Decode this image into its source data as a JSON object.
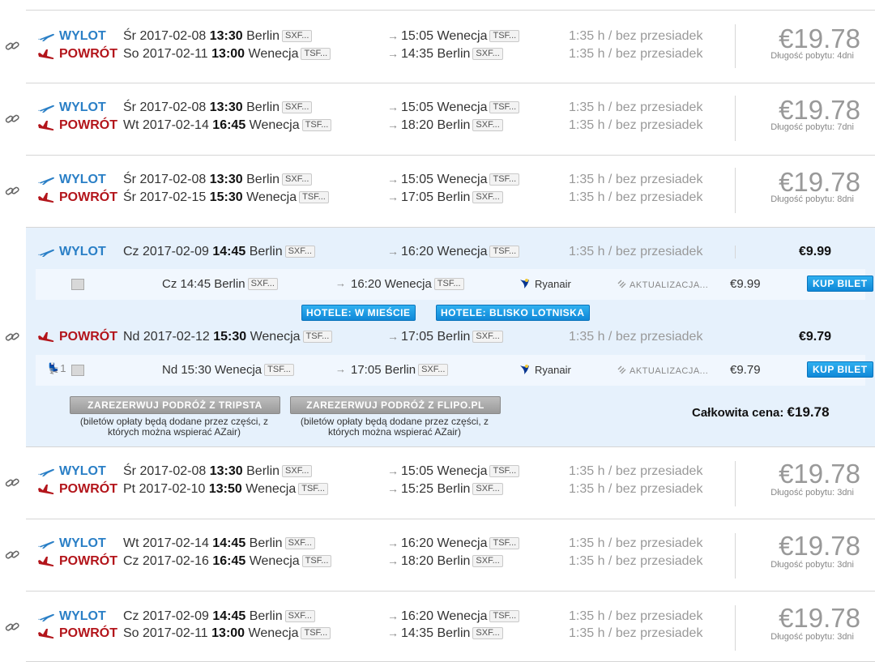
{
  "labels": {
    "outbound": "WYLOT",
    "return": "POWRÓT",
    "stay_prefix": "Długość pobytu:",
    "kup": "KUP BILET",
    "update": "AKTUALIZACJA...",
    "hotel_city": "HOTELE: W MIEŚCIE",
    "hotel_airport": "HOTELE: BLISKO LOTNISKA",
    "book_tripsta": "ZAREZERWUJ PODRÓŻ Z TRIPSTA",
    "book_flipo": "ZAREZERWUJ PODRÓŻ Z FLIPO.PL",
    "book_note": "(biletów opłaty będą dodane przez części, z których można wspierać AZair)",
    "total_label": "Całkowita cena:"
  },
  "results": [
    {
      "price": "€19.78",
      "stay": "Długość pobytu: 4dni",
      "out": {
        "day": "Śr",
        "date": "2017-02-08",
        "time": "13:30",
        "from": "Berlin",
        "from_code": "SXF...",
        "arr_time": "15:05",
        "to": "Wenecja",
        "to_code": "TSF...",
        "duration": "1:35 h / bez przesiadek"
      },
      "ret": {
        "day": "So",
        "date": "2017-02-11",
        "time": "13:00",
        "from": "Wenecja",
        "from_code": "TSF...",
        "arr_time": "14:35",
        "to": "Berlin",
        "to_code": "SXF...",
        "duration": "1:35 h / bez przesiadek"
      }
    },
    {
      "price": "€19.78",
      "stay": "Długość pobytu: 7dni",
      "out": {
        "day": "Śr",
        "date": "2017-02-08",
        "time": "13:30",
        "from": "Berlin",
        "from_code": "SXF...",
        "arr_time": "15:05",
        "to": "Wenecja",
        "to_code": "TSF...",
        "duration": "1:35 h / bez przesiadek"
      },
      "ret": {
        "day": "Wt",
        "date": "2017-02-14",
        "time": "16:45",
        "from": "Wenecja",
        "from_code": "TSF...",
        "arr_time": "18:20",
        "to": "Berlin",
        "to_code": "SXF...",
        "duration": "1:35 h / bez przesiadek"
      }
    },
    {
      "price": "€19.78",
      "stay": "Długość pobytu: 8dni",
      "out": {
        "day": "Śr",
        "date": "2017-02-08",
        "time": "13:30",
        "from": "Berlin",
        "from_code": "SXF...",
        "arr_time": "15:05",
        "to": "Wenecja",
        "to_code": "TSF...",
        "duration": "1:35 h / bez przesiadek"
      },
      "ret": {
        "day": "Śr",
        "date": "2017-02-15",
        "time": "15:30",
        "from": "Wenecja",
        "from_code": "TSF...",
        "arr_time": "17:05",
        "to": "Berlin",
        "to_code": "SXF...",
        "duration": "1:35 h / bez przesiadek"
      }
    },
    {
      "price": "€19.78",
      "stay": "Długość pobytu: 3dni",
      "out": {
        "day": "Śr",
        "date": "2017-02-08",
        "time": "13:30",
        "from": "Berlin",
        "from_code": "SXF...",
        "arr_time": "15:05",
        "to": "Wenecja",
        "to_code": "TSF...",
        "duration": "1:35 h / bez przesiadek"
      },
      "ret": {
        "day": "Pt",
        "date": "2017-02-10",
        "time": "13:50",
        "from": "Wenecja",
        "from_code": "TSF...",
        "arr_time": "15:25",
        "to": "Berlin",
        "to_code": "SXF...",
        "duration": "1:35 h / bez przesiadek"
      }
    },
    {
      "price": "€19.78",
      "stay": "Długość pobytu: 3dni",
      "out": {
        "day": "Wt",
        "date": "2017-02-14",
        "time": "14:45",
        "from": "Berlin",
        "from_code": "SXF...",
        "arr_time": "16:20",
        "to": "Wenecja",
        "to_code": "TSF...",
        "duration": "1:35 h / bez przesiadek"
      },
      "ret": {
        "day": "Cz",
        "date": "2017-02-16",
        "time": "16:45",
        "from": "Wenecja",
        "from_code": "TSF...",
        "arr_time": "18:20",
        "to": "Berlin",
        "to_code": "SXF...",
        "duration": "1:35 h / bez przesiadek"
      }
    },
    {
      "price": "€19.78",
      "stay": "Długość pobytu: 3dni",
      "out": {
        "day": "Cz",
        "date": "2017-02-09",
        "time": "14:45",
        "from": "Berlin",
        "from_code": "SXF...",
        "arr_time": "16:20",
        "to": "Wenecja",
        "to_code": "TSF...",
        "duration": "1:35 h / bez przesiadek"
      },
      "ret": {
        "day": "So",
        "date": "2017-02-11",
        "time": "13:00",
        "from": "Wenecja",
        "from_code": "TSF...",
        "arr_time": "14:35",
        "to": "Berlin",
        "to_code": "SXF...",
        "duration": "1:35 h / bez przesiadek"
      }
    }
  ],
  "expanded": {
    "total": "€19.78",
    "out": {
      "day": "Cz",
      "date": "2017-02-09",
      "time": "14:45",
      "from": "Berlin",
      "from_code": "SXF...",
      "arr_time": "16:20",
      "to": "Wenecja",
      "to_code": "TSF...",
      "duration": "1:35 h / bez przesiadek",
      "price": "€9.99",
      "segment": {
        "dep": "Cz 14:45 Berlin",
        "dep_code": "SXF...",
        "arr": "16:20 Wenecja",
        "arr_code": "TSF...",
        "airline": "Ryanair",
        "price": "€9.99"
      }
    },
    "ret": {
      "day": "Nd",
      "date": "2017-02-12",
      "time": "15:30",
      "from": "Wenecja",
      "from_code": "TSF...",
      "arr_time": "17:05",
      "to": "Berlin",
      "to_code": "SXF...",
      "duration": "1:35 h / bez przesiadek",
      "price": "€9.79",
      "segment": {
        "seats": "1",
        "dep": "Nd 15:30 Wenecja",
        "dep_code": "TSF...",
        "arr": "17:05 Berlin",
        "arr_code": "SXF...",
        "airline": "Ryanair",
        "price": "€9.79"
      }
    }
  },
  "icons": {
    "link": "link-icon",
    "outbound": "plane-takeoff-icon",
    "return": "plane-landing-icon",
    "airline": "ryanair-logo",
    "update": "refresh-icon",
    "seat": "seat-icon",
    "photo": "image-icon"
  },
  "colors": {
    "outbound": "#2a7fc6",
    "return": "#b3151b",
    "expanded_bg": "#e6f1fc",
    "button": "#1a98e2"
  }
}
